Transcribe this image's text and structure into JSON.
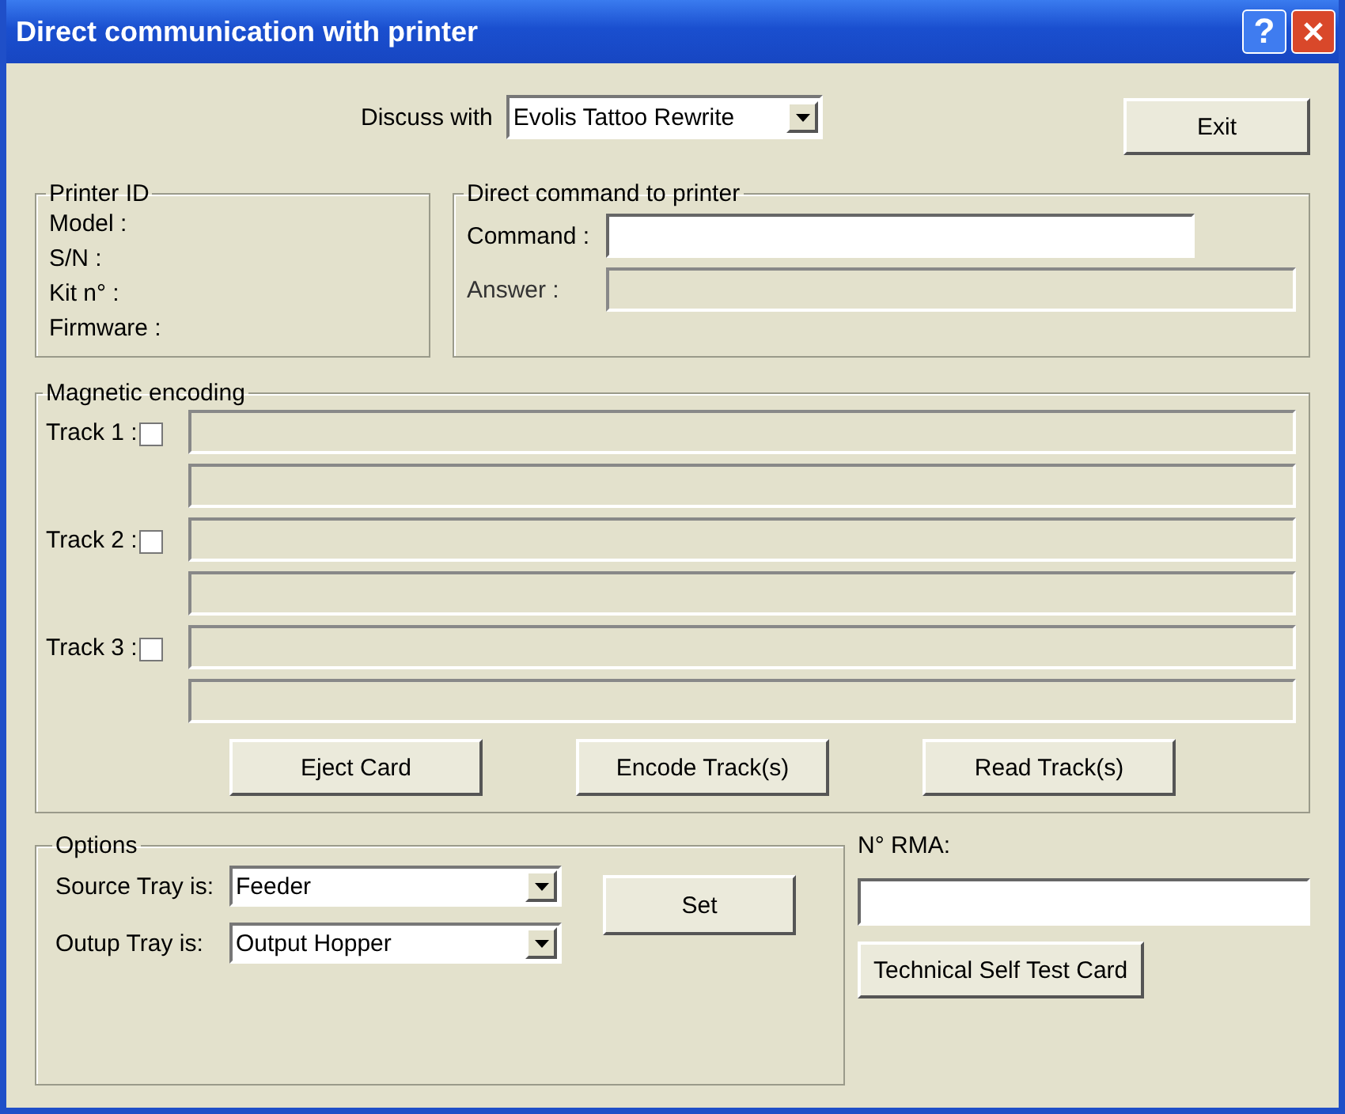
{
  "window": {
    "title": "Direct communication with printer",
    "help_label": "?"
  },
  "discuss": {
    "label": "Discuss with",
    "value": "Evolis Tattoo Rewrite"
  },
  "exit_button": "Exit",
  "printer_id": {
    "title": "Printer ID",
    "fields": [
      "Model :",
      "S/N :",
      "Kit n° :",
      "Firmware :"
    ]
  },
  "direct_command": {
    "title": "Direct command to printer",
    "command": {
      "label": "Command :",
      "disabled": false
    },
    "answer": {
      "label": "Answer :",
      "disabled": true
    }
  },
  "magnetic": {
    "title": "Magnetic encoding",
    "tracks": [
      {
        "label": "Track 1 :",
        "checked": false,
        "disabled": true
      },
      {
        "label": "Track 2 :",
        "checked": false,
        "disabled": true
      },
      {
        "label": "Track 3 :",
        "checked": false,
        "disabled": true
      }
    ],
    "buttons": [
      "Eject Card",
      "Encode Track(s)",
      "Read Track(s)"
    ]
  },
  "options": {
    "title": "Options",
    "rows": [
      {
        "label": "Source Tray is:",
        "value": "Feeder"
      },
      {
        "label": "Outup Tray is:",
        "value": "Output Hopper"
      }
    ],
    "set_button": "Set"
  },
  "rma": {
    "label": "N° RMA:",
    "button": "Technical Self Test Card"
  }
}
